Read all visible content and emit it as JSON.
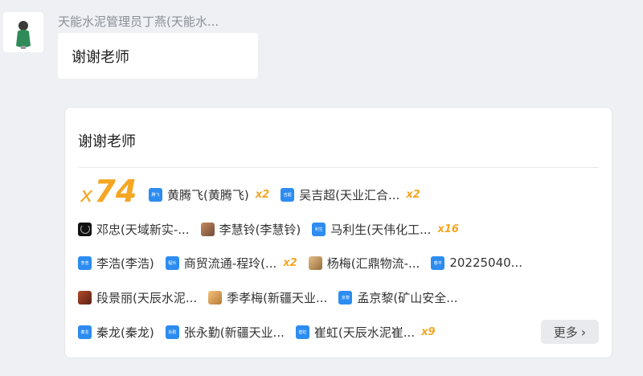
{
  "message": {
    "sender": "天能水泥管理员丁燕(天能水...",
    "text": "谢谢老师"
  },
  "card": {
    "title": "谢谢老师",
    "total": {
      "x": "x",
      "count": "74"
    },
    "more_label": "更多",
    "rows": [
      [
        {
          "name": "黄腾飞(黄腾飞)",
          "mult": "x2",
          "icon": "blue",
          "icon_text": "腾飞"
        },
        {
          "name": "吴吉超(天业汇合...",
          "mult": "x2",
          "icon": "blue",
          "icon_text": "吉超"
        }
      ],
      [
        {
          "name": "邓忠(天域新实-...",
          "mult": "",
          "icon": "dark",
          "icon_text": ""
        },
        {
          "name": "李慧铃(李慧铃)",
          "mult": "",
          "icon": "photo",
          "icon_text": ""
        },
        {
          "name": "马利生(天伟化工...",
          "mult": "x16",
          "icon": "blue",
          "icon_text": "利生"
        }
      ],
      [
        {
          "name": "李浩(李浩)",
          "mult": "",
          "icon": "blue",
          "icon_text": "李浩"
        },
        {
          "name": "商贸流通-程玲(...",
          "mult": "x2",
          "icon": "blue",
          "icon_text": "程玲"
        },
        {
          "name": "杨梅(汇鼎物流-...",
          "mult": "",
          "icon": "photo2",
          "icon_text": ""
        },
        {
          "name": "20225040...",
          "mult": "",
          "icon": "blue",
          "icon_text": "春平"
        }
      ],
      [
        {
          "name": "段景丽(天辰水泥...",
          "mult": "",
          "icon": "photo3",
          "icon_text": ""
        },
        {
          "name": "季孝梅(新疆天业...",
          "mult": "",
          "icon": "photo4",
          "icon_text": ""
        },
        {
          "name": "孟京黎(矿山安全...",
          "mult": "",
          "icon": "blue",
          "icon_text": "京黎"
        }
      ],
      [
        {
          "name": "秦龙(秦龙)",
          "mult": "",
          "icon": "blue",
          "icon_text": "秦龙"
        },
        {
          "name": "张永勤(新疆天业...",
          "mult": "",
          "icon": "blue",
          "icon_text": "永勤"
        },
        {
          "name": "崔虹(天辰水泥崔...",
          "mult": "x9",
          "icon": "blue",
          "icon_text": "崔虹"
        }
      ]
    ]
  }
}
